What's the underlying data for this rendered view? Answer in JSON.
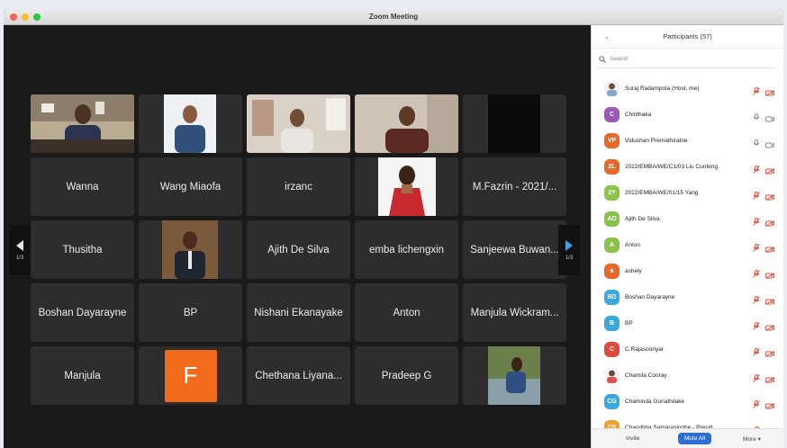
{
  "window": {
    "title": "Zoom Meeting"
  },
  "gallery": {
    "page_left": "1/3",
    "page_right": "1/3",
    "tiles": [
      {
        "type": "video",
        "name": ""
      },
      {
        "type": "video",
        "name": ""
      },
      {
        "type": "video",
        "name": ""
      },
      {
        "type": "video",
        "name": ""
      },
      {
        "type": "dark",
        "name": ""
      },
      {
        "type": "name",
        "name": "Wanna"
      },
      {
        "type": "name",
        "name": "Wang Miaofa"
      },
      {
        "type": "name",
        "name": "irzanc"
      },
      {
        "type": "video",
        "name": ""
      },
      {
        "type": "name",
        "name": "M.Fazrin - 2021/..."
      },
      {
        "type": "name",
        "name": "Thusitha"
      },
      {
        "type": "video",
        "name": ""
      },
      {
        "type": "name",
        "name": "Ajith De Silva"
      },
      {
        "type": "name",
        "name": "emba lichengxin"
      },
      {
        "type": "name",
        "name": "Sanjeewa Buwan..."
      },
      {
        "type": "name",
        "name": "Boshan Dayarayne"
      },
      {
        "type": "name",
        "name": "BP"
      },
      {
        "type": "name",
        "name": "Nishani Ekanayake"
      },
      {
        "type": "name",
        "name": "Anton"
      },
      {
        "type": "name",
        "name": "Manjula Wickram..."
      },
      {
        "type": "name",
        "name": "Manjula"
      },
      {
        "type": "initial",
        "name": "F",
        "color": "#f26a1b"
      },
      {
        "type": "name",
        "name": "Chethana Liyana..."
      },
      {
        "type": "name",
        "name": "Pradeep G"
      },
      {
        "type": "video",
        "name": ""
      }
    ]
  },
  "participants": {
    "title": "Participants (57)",
    "search_placeholder": "Search",
    "list": [
      {
        "name": "Suraj Radampola (Host, me)",
        "initials": "",
        "color": "#8aa3c8",
        "photo": true,
        "muted": true
      },
      {
        "name": "Chinthaka",
        "initials": "C",
        "color": "#9b59b6",
        "photo": false,
        "muted": false
      },
      {
        "name": "Vidushan Premathiratne",
        "initials": "VP",
        "color": "#e8682a",
        "photo": false,
        "muted": false
      },
      {
        "name": "2022/EMBA/WE/C1/03 Liu Cunfeng",
        "initials": "2L",
        "color": "#e8682a",
        "photo": false,
        "muted": true
      },
      {
        "name": "2022/EMBA/WE/01/15 Yang",
        "initials": "2Y",
        "color": "#8bc34a",
        "photo": false,
        "muted": true
      },
      {
        "name": "Ajith De Silva",
        "initials": "AD",
        "color": "#8bc34a",
        "photo": false,
        "muted": true
      },
      {
        "name": "Anton",
        "initials": "A",
        "color": "#8bc34a",
        "photo": false,
        "muted": true
      },
      {
        "name": "ashely",
        "initials": "a",
        "color": "#e8682a",
        "photo": false,
        "muted": true
      },
      {
        "name": "Boshan Dayarayne",
        "initials": "BD",
        "color": "#3aa8dc",
        "photo": false,
        "muted": true
      },
      {
        "name": "BP",
        "initials": "B",
        "color": "#3aa8dc",
        "photo": false,
        "muted": true
      },
      {
        "name": "C.Rajasooriyar",
        "initials": "C",
        "color": "#e04a3a",
        "photo": false,
        "muted": true
      },
      {
        "name": "Chamila Cooray",
        "initials": "",
        "color": "#d9534f",
        "photo": true,
        "muted": true
      },
      {
        "name": "Chaminda Gunathilake",
        "initials": "CG",
        "color": "#3aa8dc",
        "photo": false,
        "muted": true
      },
      {
        "name": "Chandima Samarasinghe - Presid...",
        "initials": "CS",
        "color": "#f0a030",
        "photo": false,
        "muted": true
      }
    ],
    "invite": "Invite",
    "mute_all": "Mute All",
    "more": "More ▾"
  }
}
